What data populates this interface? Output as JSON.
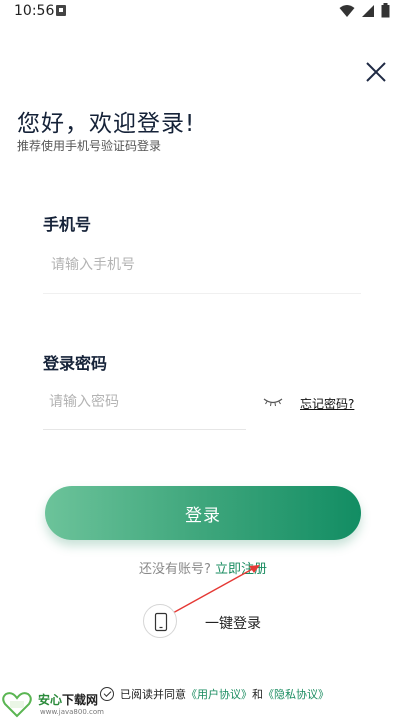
{
  "status_bar": {
    "time": "10:56"
  },
  "header": {
    "greeting": "您好，欢迎登录!",
    "subtitle": "推荐使用手机号验证码登录"
  },
  "phone": {
    "label": "手机号",
    "placeholder": "请输入手机号"
  },
  "password": {
    "label": "登录密码",
    "placeholder": "请输入密码",
    "forgot": "忘记密码?"
  },
  "login_button": "登录",
  "register": {
    "prompt": "还没有账号?",
    "link": "立即注册"
  },
  "one_key_login": "一键登录",
  "agreement": {
    "prefix": "已阅读并同意",
    "user_agreement": "《用户协议》",
    "and": "和",
    "privacy_agreement": "《隐私协议》"
  },
  "watermark": {
    "name_green": "安心",
    "name_dark": "下载网",
    "url": "www.java800.com"
  },
  "colors": {
    "accent": "#1a8c60",
    "button_start": "#6cc39a",
    "button_end": "#128d63",
    "annotation_arrow": "#e53935"
  }
}
